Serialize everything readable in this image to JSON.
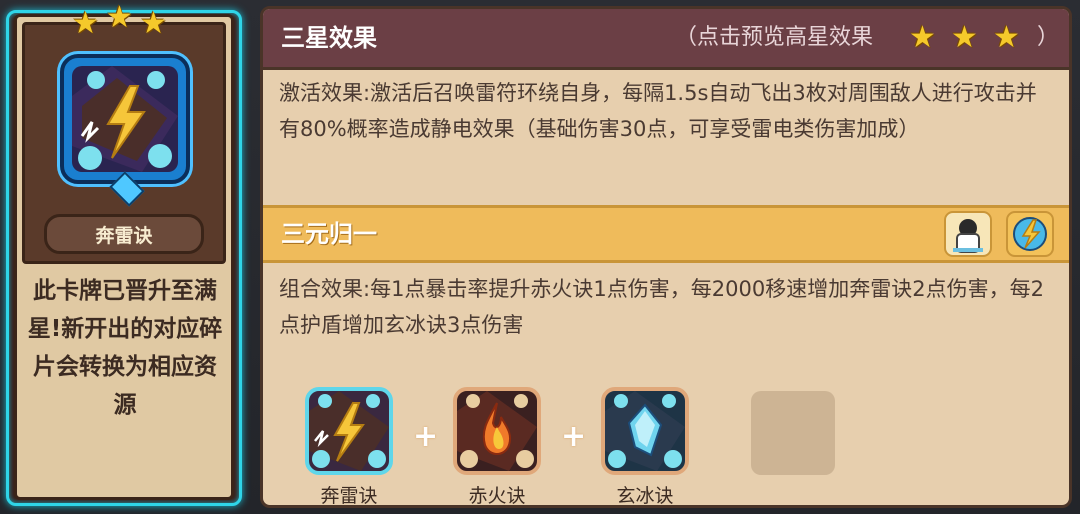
{
  "card": {
    "star_count": 3,
    "name": "奔雷诀",
    "description": "此卡牌已晋升至满星!新开出的对应碎片会转换为相应资源",
    "icon": "lightning-talisman-icon"
  },
  "panel": {
    "header": {
      "title": "三星效果",
      "hint": "（点击预览高星效果",
      "close_paren": "）",
      "star_count": 3
    },
    "effect_text": "激活效果:激活后召唤雷符环绕自身，每隔1.5s自动飞出3枚对周围敌人进行攻击并有80%概率造成静电效果（基础伤害30点，可享受雷电类伤害加成）",
    "combo": {
      "title": "三元归一",
      "badges": [
        "hero-portrait-icon",
        "lightning-orb-icon"
      ],
      "text": "组合效果:每1点暴击率提升赤火诀1点伤害，每2000移速增加奔雷诀2点伤害，每2点护盾增加玄冰诀3点伤害"
    },
    "skills": [
      {
        "name": "奔雷诀",
        "icon": "lightning-skill-icon"
      },
      {
        "name": "赤火诀",
        "icon": "fire-skill-icon"
      },
      {
        "name": "玄冰诀",
        "icon": "ice-skill-icon"
      }
    ],
    "plus_symbol": "+"
  },
  "colors": {
    "card_glow": "#2fd5e8",
    "header_bg": "#6b3f45",
    "combo_bg": "#efbb5b",
    "panel_bg": "#e7cfae",
    "star": "#f5c92b"
  }
}
